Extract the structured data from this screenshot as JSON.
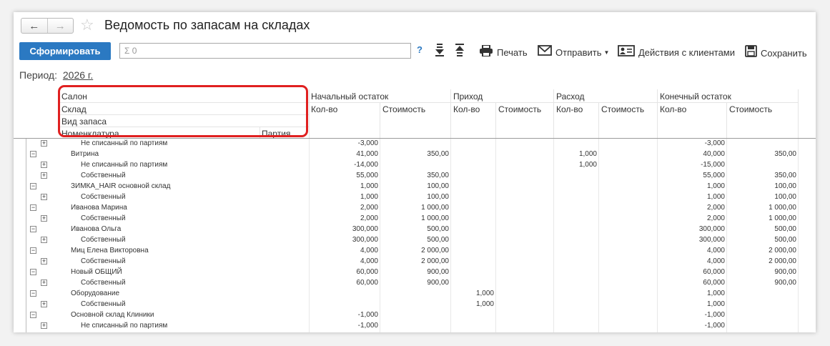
{
  "window": {
    "title": "Ведомость по запасам на складах"
  },
  "nav": {
    "back_icon": "arrow-left-icon",
    "forward_icon": "arrow-right-icon"
  },
  "toolbar": {
    "generate_label": "Сформировать",
    "search_value": "Σ 0",
    "help_label": "?",
    "print_label": "Печать",
    "send_label": "Отправить",
    "clients_label": "Действия с клиентами",
    "save_label": "Сохранить"
  },
  "period": {
    "label": "Период:",
    "value": "2026 г."
  },
  "header": {
    "group_levels": [
      "Салон",
      "Склад",
      "Вид запаса",
      "Номенклатура"
    ],
    "batch": "Партия",
    "groups": [
      "Начальный остаток",
      "Приход",
      "Расход",
      "Конечный остаток"
    ],
    "qty": "Кол-во",
    "cost": "Стоимость"
  },
  "rows": [
    {
      "level": 2,
      "toggle": "+",
      "label": "Не списанный по партиям",
      "v": [
        "-3,000",
        "",
        "",
        "",
        "",
        "",
        "-3,000",
        ""
      ]
    },
    {
      "level": 1,
      "toggle": "−",
      "label": "Витрина",
      "v": [
        "41,000",
        "350,00",
        "",
        "",
        "1,000",
        "",
        "40,000",
        "350,00"
      ]
    },
    {
      "level": 2,
      "toggle": "+",
      "label": "Не списанный по партиям",
      "v": [
        "-14,000",
        "",
        "",
        "",
        "1,000",
        "",
        "-15,000",
        ""
      ]
    },
    {
      "level": 2,
      "toggle": "+",
      "label": "Собственный",
      "v": [
        "55,000",
        "350,00",
        "",
        "",
        "",
        "",
        "55,000",
        "350,00"
      ]
    },
    {
      "level": 1,
      "toggle": "−",
      "label": "ЗИМКА_HAIR основной склад",
      "v": [
        "1,000",
        "100,00",
        "",
        "",
        "",
        "",
        "1,000",
        "100,00"
      ]
    },
    {
      "level": 2,
      "toggle": "+",
      "label": "Собственный",
      "v": [
        "1,000",
        "100,00",
        "",
        "",
        "",
        "",
        "1,000",
        "100,00"
      ]
    },
    {
      "level": 1,
      "toggle": "−",
      "label": "Иванова Марина",
      "v": [
        "2,000",
        "1 000,00",
        "",
        "",
        "",
        "",
        "2,000",
        "1 000,00"
      ]
    },
    {
      "level": 2,
      "toggle": "+",
      "label": "Собственный",
      "v": [
        "2,000",
        "1 000,00",
        "",
        "",
        "",
        "",
        "2,000",
        "1 000,00"
      ]
    },
    {
      "level": 1,
      "toggle": "−",
      "label": "Иванова Ольга",
      "v": [
        "300,000",
        "500,00",
        "",
        "",
        "",
        "",
        "300,000",
        "500,00"
      ]
    },
    {
      "level": 2,
      "toggle": "+",
      "label": "Собственный",
      "v": [
        "300,000",
        "500,00",
        "",
        "",
        "",
        "",
        "300,000",
        "500,00"
      ]
    },
    {
      "level": 1,
      "toggle": "−",
      "label": "Миц Елена Викторовна",
      "v": [
        "4,000",
        "2 000,00",
        "",
        "",
        "",
        "",
        "4,000",
        "2 000,00"
      ]
    },
    {
      "level": 2,
      "toggle": "+",
      "label": "Собственный",
      "v": [
        "4,000",
        "2 000,00",
        "",
        "",
        "",
        "",
        "4,000",
        "2 000,00"
      ]
    },
    {
      "level": 1,
      "toggle": "−",
      "label": "Новый ОБЩИЙ",
      "v": [
        "60,000",
        "900,00",
        "",
        "",
        "",
        "",
        "60,000",
        "900,00"
      ]
    },
    {
      "level": 2,
      "toggle": "+",
      "label": "Собственный",
      "v": [
        "60,000",
        "900,00",
        "",
        "",
        "",
        "",
        "60,000",
        "900,00"
      ]
    },
    {
      "level": 1,
      "toggle": "−",
      "label": "Оборудование",
      "v": [
        "",
        "",
        "1,000",
        "",
        "",
        "",
        "1,000",
        ""
      ]
    },
    {
      "level": 2,
      "toggle": "+",
      "label": "Собственный",
      "v": [
        "",
        "",
        "1,000",
        "",
        "",
        "",
        "1,000",
        ""
      ]
    },
    {
      "level": 1,
      "toggle": "−",
      "label": "Основной склад Клиники",
      "v": [
        "-1,000",
        "",
        "",
        "",
        "",
        "",
        "-1,000",
        ""
      ]
    },
    {
      "level": 2,
      "toggle": "+",
      "label": "Не списанный по партиям",
      "v": [
        "-1,000",
        "",
        "",
        "",
        "",
        "",
        "-1,000",
        ""
      ]
    }
  ]
}
